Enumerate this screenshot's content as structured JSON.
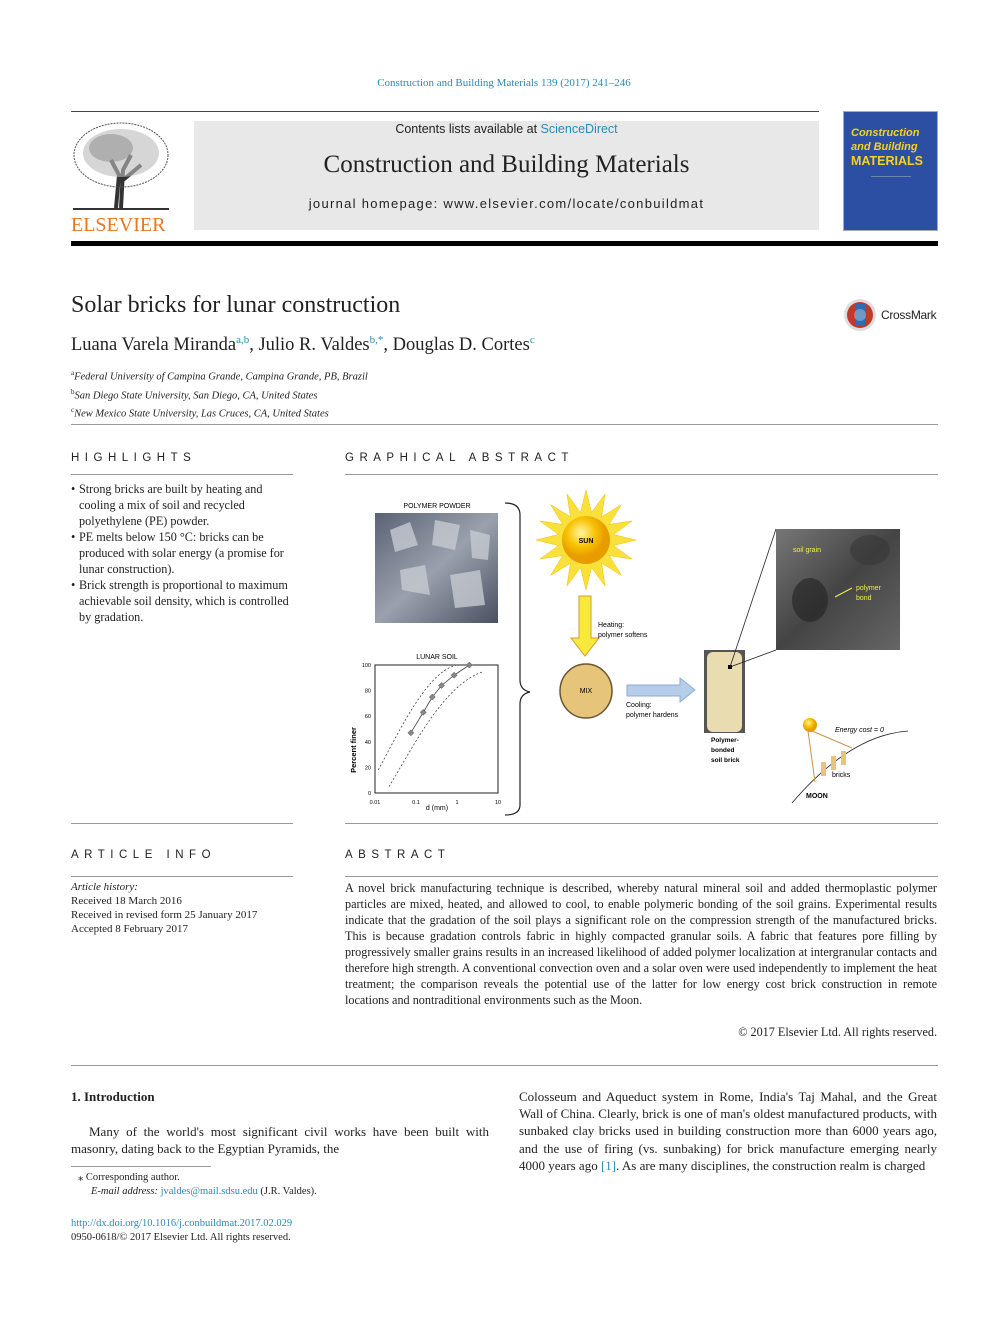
{
  "header": {
    "citation": "Construction and Building Materials 139 (2017) 241–246",
    "contents_prefix": "Contents lists available at ",
    "sciencedirect": "ScienceDirect",
    "journal_title": "Construction and Building Materials",
    "homepage": "journal homepage: www.elsevier.com/locate/conbuildmat",
    "publisher_logo": "ELSEVIER",
    "cover": {
      "line1": "Construction",
      "line2": "and Building",
      "line3": "MATERIALS"
    },
    "colors": {
      "link": "#2a8ab5",
      "elsevier_orange": "#e87722",
      "cover_blue": "#2c4fa3",
      "cover_yellow": "#f5d21f"
    }
  },
  "article": {
    "title": "Solar bricks for lunar construction",
    "crossmark": "CrossMark",
    "authors": [
      {
        "name": "Luana Varela Miranda",
        "sup": "a,b"
      },
      {
        "name": "Julio R. Valdes",
        "sup": "b,*"
      },
      {
        "name": "Douglas D. Cortes",
        "sup": "c"
      }
    ],
    "affiliations": [
      {
        "sup": "a",
        "text": "Federal University of Campina Grande, Campina Grande, PB, Brazil"
      },
      {
        "sup": "b",
        "text": "San Diego State University, San Diego, CA, United States"
      },
      {
        "sup": "c",
        "text": "New Mexico State University, Las Cruces, CA, United States"
      }
    ]
  },
  "highlights": {
    "heading": "HIGHLIGHTS",
    "items": [
      "Strong bricks are built by heating and cooling a mix of soil and recycled polyethylene (PE) powder.",
      "PE melts below 150 °C: bricks can be produced with solar energy (a promise for lunar construction).",
      "Brick strength is proportional to maximum achievable soil density, which is controlled by gradation."
    ]
  },
  "graphical_abstract": {
    "heading": "GRAPHICAL ABSTRACT",
    "polymer_powder": "POLYMER POWDER",
    "lunar_soil": "LUNAR SOIL",
    "ylabel": "Percent finer",
    "xlabel": "d (mm)",
    "yticks": [
      "0",
      "20",
      "40",
      "60",
      "80",
      "100"
    ],
    "xticks": [
      "0.01",
      "0.1",
      "1",
      "10"
    ],
    "soil_points": [
      [
        0.075,
        47
      ],
      [
        0.15,
        63
      ],
      [
        0.25,
        75
      ],
      [
        0.42,
        84
      ],
      [
        0.85,
        92
      ],
      [
        2,
        100
      ]
    ],
    "sun": "SUN",
    "heating1": "Heating:",
    "heating2": "polymer softens",
    "mix": "MIX",
    "cooling1": "Cooling:",
    "cooling2": "polymer hardens",
    "brick1": "Polymer-",
    "brick2": "bonded",
    "brick3": "soil brick",
    "soil_grain": "soil grain",
    "polymer1": "polymer",
    "polymer2": "bond",
    "energy": "Energy cost = 0",
    "bricks": "bricks",
    "moon": "MOON"
  },
  "article_info": {
    "heading": "ARTICLE INFO",
    "history_label": "Article history:",
    "received": "Received 18 March 2016",
    "revised": "Received in revised form 25 January 2017",
    "accepted": "Accepted 8 February 2017"
  },
  "abstract": {
    "heading": "ABSTRACT",
    "text": "A novel brick manufacturing technique is described, whereby natural mineral soil and added thermoplastic polymer particles are mixed, heated, and allowed to cool, to enable polymeric bonding of the soil grains. Experimental results indicate that the gradation of the soil plays a significant role on the compression strength of the manufactured bricks. This is because gradation controls fabric in highly compacted granular soils. A fabric that features pore filling by progressively smaller grains results in an increased likelihood of added polymer localization at intergranular contacts and therefore high strength. A conventional convection oven and a solar oven were used independently to implement the heat treatment; the comparison reveals the potential use of the latter for low energy cost brick construction in remote locations and nontraditional environments such as the Moon.",
    "copyright": "© 2017 Elsevier Ltd. All rights reserved."
  },
  "intro": {
    "heading": "1. Introduction",
    "col1": "Many of the world's most significant civil works have been built with masonry, dating back to the Egyptian Pyramids, the",
    "col2a": "Colosseum and Aqueduct system in Rome, India's Taj Mahal, and the Great Wall of China. Clearly, brick is one of man's oldest manufactured products, with sunbaked clay bricks used in building construction more than 6000 years ago, and the use of firing (vs. sunbaking) for brick manufacture emerging nearly 4000 years ago ",
    "ref": "[1]",
    "col2b": ". As are many disciplines, the construction realm is charged"
  },
  "footnote": {
    "star": "⁎",
    "corresponding": "Corresponding author.",
    "email_label": "E-mail address: ",
    "email": "jvaldes@mail.sdsu.edu",
    "email_suffix": " (J.R. Valdes)."
  },
  "footer": {
    "doi": "http://dx.doi.org/10.1016/j.conbuildmat.2017.02.029",
    "issn": "0950-0618/© 2017 Elsevier Ltd. All rights reserved."
  }
}
